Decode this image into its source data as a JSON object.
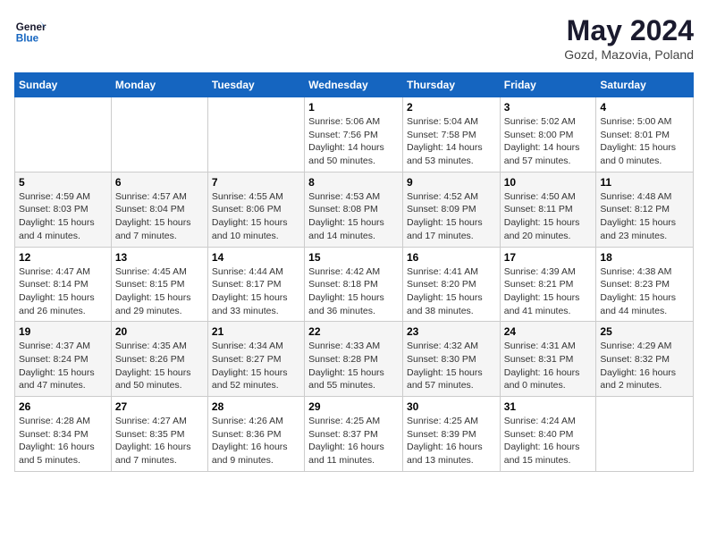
{
  "logo": {
    "line1": "General",
    "line2": "Blue"
  },
  "title": "May 2024",
  "location": "Gozd, Mazovia, Poland",
  "weekdays": [
    "Sunday",
    "Monday",
    "Tuesday",
    "Wednesday",
    "Thursday",
    "Friday",
    "Saturday"
  ],
  "weeks": [
    [
      {
        "day": "",
        "sunrise": "",
        "sunset": "",
        "daylight": ""
      },
      {
        "day": "",
        "sunrise": "",
        "sunset": "",
        "daylight": ""
      },
      {
        "day": "",
        "sunrise": "",
        "sunset": "",
        "daylight": ""
      },
      {
        "day": "1",
        "sunrise": "Sunrise: 5:06 AM",
        "sunset": "Sunset: 7:56 PM",
        "daylight": "Daylight: 14 hours and 50 minutes."
      },
      {
        "day": "2",
        "sunrise": "Sunrise: 5:04 AM",
        "sunset": "Sunset: 7:58 PM",
        "daylight": "Daylight: 14 hours and 53 minutes."
      },
      {
        "day": "3",
        "sunrise": "Sunrise: 5:02 AM",
        "sunset": "Sunset: 8:00 PM",
        "daylight": "Daylight: 14 hours and 57 minutes."
      },
      {
        "day": "4",
        "sunrise": "Sunrise: 5:00 AM",
        "sunset": "Sunset: 8:01 PM",
        "daylight": "Daylight: 15 hours and 0 minutes."
      }
    ],
    [
      {
        "day": "5",
        "sunrise": "Sunrise: 4:59 AM",
        "sunset": "Sunset: 8:03 PM",
        "daylight": "Daylight: 15 hours and 4 minutes."
      },
      {
        "day": "6",
        "sunrise": "Sunrise: 4:57 AM",
        "sunset": "Sunset: 8:04 PM",
        "daylight": "Daylight: 15 hours and 7 minutes."
      },
      {
        "day": "7",
        "sunrise": "Sunrise: 4:55 AM",
        "sunset": "Sunset: 8:06 PM",
        "daylight": "Daylight: 15 hours and 10 minutes."
      },
      {
        "day": "8",
        "sunrise": "Sunrise: 4:53 AM",
        "sunset": "Sunset: 8:08 PM",
        "daylight": "Daylight: 15 hours and 14 minutes."
      },
      {
        "day": "9",
        "sunrise": "Sunrise: 4:52 AM",
        "sunset": "Sunset: 8:09 PM",
        "daylight": "Daylight: 15 hours and 17 minutes."
      },
      {
        "day": "10",
        "sunrise": "Sunrise: 4:50 AM",
        "sunset": "Sunset: 8:11 PM",
        "daylight": "Daylight: 15 hours and 20 minutes."
      },
      {
        "day": "11",
        "sunrise": "Sunrise: 4:48 AM",
        "sunset": "Sunset: 8:12 PM",
        "daylight": "Daylight: 15 hours and 23 minutes."
      }
    ],
    [
      {
        "day": "12",
        "sunrise": "Sunrise: 4:47 AM",
        "sunset": "Sunset: 8:14 PM",
        "daylight": "Daylight: 15 hours and 26 minutes."
      },
      {
        "day": "13",
        "sunrise": "Sunrise: 4:45 AM",
        "sunset": "Sunset: 8:15 PM",
        "daylight": "Daylight: 15 hours and 29 minutes."
      },
      {
        "day": "14",
        "sunrise": "Sunrise: 4:44 AM",
        "sunset": "Sunset: 8:17 PM",
        "daylight": "Daylight: 15 hours and 33 minutes."
      },
      {
        "day": "15",
        "sunrise": "Sunrise: 4:42 AM",
        "sunset": "Sunset: 8:18 PM",
        "daylight": "Daylight: 15 hours and 36 minutes."
      },
      {
        "day": "16",
        "sunrise": "Sunrise: 4:41 AM",
        "sunset": "Sunset: 8:20 PM",
        "daylight": "Daylight: 15 hours and 38 minutes."
      },
      {
        "day": "17",
        "sunrise": "Sunrise: 4:39 AM",
        "sunset": "Sunset: 8:21 PM",
        "daylight": "Daylight: 15 hours and 41 minutes."
      },
      {
        "day": "18",
        "sunrise": "Sunrise: 4:38 AM",
        "sunset": "Sunset: 8:23 PM",
        "daylight": "Daylight: 15 hours and 44 minutes."
      }
    ],
    [
      {
        "day": "19",
        "sunrise": "Sunrise: 4:37 AM",
        "sunset": "Sunset: 8:24 PM",
        "daylight": "Daylight: 15 hours and 47 minutes."
      },
      {
        "day": "20",
        "sunrise": "Sunrise: 4:35 AM",
        "sunset": "Sunset: 8:26 PM",
        "daylight": "Daylight: 15 hours and 50 minutes."
      },
      {
        "day": "21",
        "sunrise": "Sunrise: 4:34 AM",
        "sunset": "Sunset: 8:27 PM",
        "daylight": "Daylight: 15 hours and 52 minutes."
      },
      {
        "day": "22",
        "sunrise": "Sunrise: 4:33 AM",
        "sunset": "Sunset: 8:28 PM",
        "daylight": "Daylight: 15 hours and 55 minutes."
      },
      {
        "day": "23",
        "sunrise": "Sunrise: 4:32 AM",
        "sunset": "Sunset: 8:30 PM",
        "daylight": "Daylight: 15 hours and 57 minutes."
      },
      {
        "day": "24",
        "sunrise": "Sunrise: 4:31 AM",
        "sunset": "Sunset: 8:31 PM",
        "daylight": "Daylight: 16 hours and 0 minutes."
      },
      {
        "day": "25",
        "sunrise": "Sunrise: 4:29 AM",
        "sunset": "Sunset: 8:32 PM",
        "daylight": "Daylight: 16 hours and 2 minutes."
      }
    ],
    [
      {
        "day": "26",
        "sunrise": "Sunrise: 4:28 AM",
        "sunset": "Sunset: 8:34 PM",
        "daylight": "Daylight: 16 hours and 5 minutes."
      },
      {
        "day": "27",
        "sunrise": "Sunrise: 4:27 AM",
        "sunset": "Sunset: 8:35 PM",
        "daylight": "Daylight: 16 hours and 7 minutes."
      },
      {
        "day": "28",
        "sunrise": "Sunrise: 4:26 AM",
        "sunset": "Sunset: 8:36 PM",
        "daylight": "Daylight: 16 hours and 9 minutes."
      },
      {
        "day": "29",
        "sunrise": "Sunrise: 4:25 AM",
        "sunset": "Sunset: 8:37 PM",
        "daylight": "Daylight: 16 hours and 11 minutes."
      },
      {
        "day": "30",
        "sunrise": "Sunrise: 4:25 AM",
        "sunset": "Sunset: 8:39 PM",
        "daylight": "Daylight: 16 hours and 13 minutes."
      },
      {
        "day": "31",
        "sunrise": "Sunrise: 4:24 AM",
        "sunset": "Sunset: 8:40 PM",
        "daylight": "Daylight: 16 hours and 15 minutes."
      },
      {
        "day": "",
        "sunrise": "",
        "sunset": "",
        "daylight": ""
      }
    ]
  ]
}
